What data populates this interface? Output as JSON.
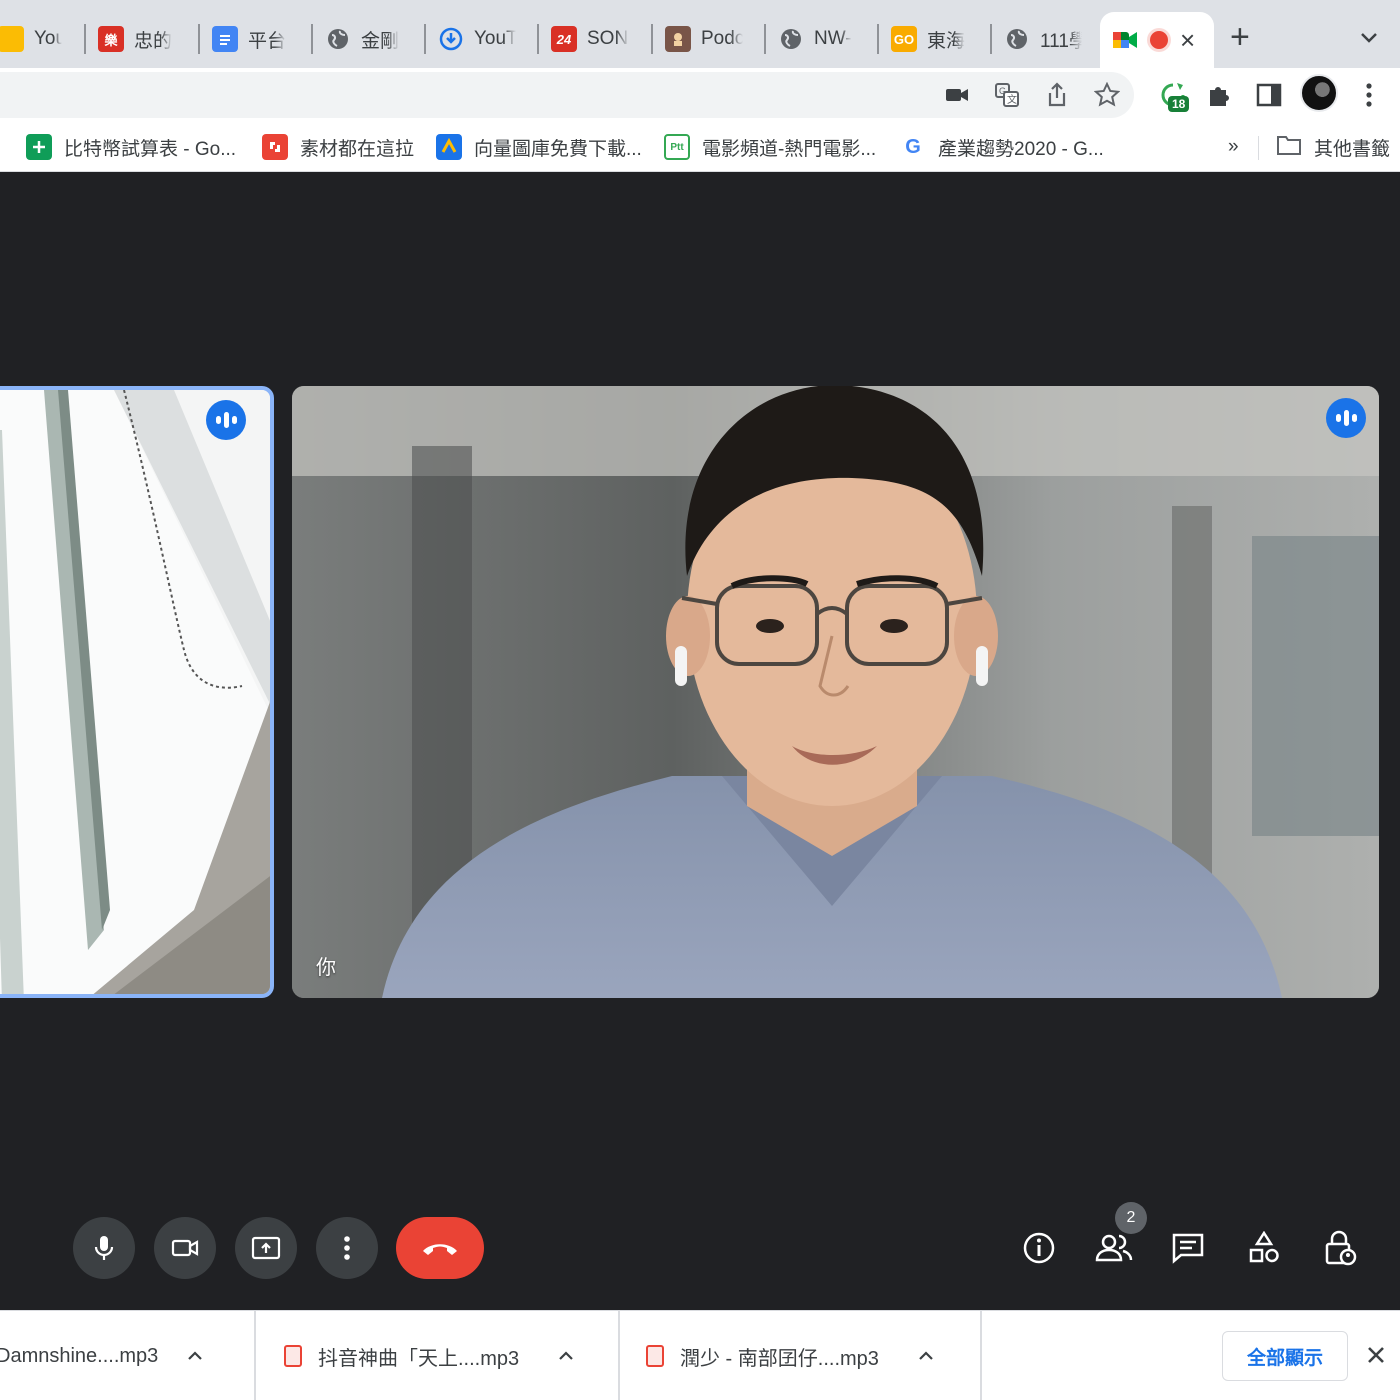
{
  "tabs": [
    {
      "title": "Your",
      "icon_color": "#fbbc04",
      "icon": "drive-icon"
    },
    {
      "title": "忠的",
      "icon_color": "#d93025",
      "icon": "site-icon"
    },
    {
      "title": "平台",
      "icon_color": "#4285f4",
      "icon": "docs-icon"
    },
    {
      "title": "金剛",
      "icon_color": "#5f6368",
      "icon": "globe-icon"
    },
    {
      "title": "YouTu",
      "icon_color": "#1a73e8",
      "icon": "download-icon"
    },
    {
      "title": "SONY",
      "icon_color": "#d93025",
      "icon": "news-icon"
    },
    {
      "title": "Podc",
      "icon_color": "#795548",
      "icon": "podcast-icon"
    },
    {
      "title": "NW-",
      "icon_color": "#5f6368",
      "icon": "globe-icon"
    },
    {
      "title": "東海",
      "icon_color": "#f9ab00",
      "icon": "site-icon"
    },
    {
      "title": "111學",
      "icon_color": "#5f6368",
      "icon": "globe-icon"
    }
  ],
  "bookmarks": [
    {
      "label": "比特幣試算表 - Go...",
      "icon_color": "#0f9d58",
      "icon": "sheets-icon"
    },
    {
      "label": "素材都在這拉",
      "icon_color": "#ea4335",
      "icon": "site-icon"
    },
    {
      "label": "向量圖庫免費下載...",
      "icon_color": "#1a73e8",
      "icon": "vector-icon"
    },
    {
      "label": "電影頻道-熱門電影...",
      "icon_color": "#34a853",
      "icon": "ptt-icon"
    },
    {
      "label": "產業趨勢2020 - G...",
      "icon_color": "#4285f4",
      "icon": "google-icon"
    }
  ],
  "bookmarks_more": "»",
  "other_bookmarks": "其他書籤",
  "extensions_badge": "18",
  "stage": {
    "tile_label": "你",
    "participant_count": "2"
  },
  "downloads": [
    {
      "name": "Damnshine....mp3"
    },
    {
      "name": "抖音神曲「天上....mp3"
    },
    {
      "name": "潤少 - 南部囝仔....mp3"
    }
  ],
  "show_all_label": "全部顯示",
  "tab_icon_labels": {
    "sony": "24",
    "ptt": "Ptt",
    "google": "G"
  }
}
